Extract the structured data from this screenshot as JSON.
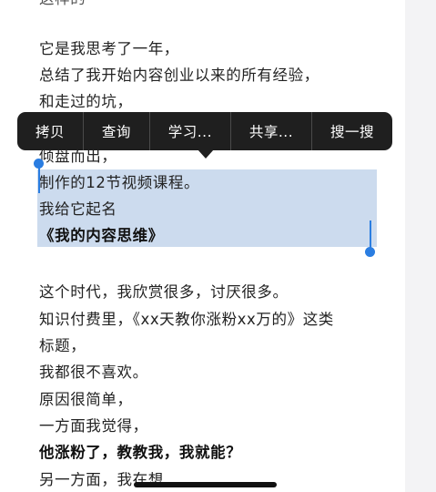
{
  "context_menu": {
    "items": [
      {
        "label": "拷贝"
      },
      {
        "label": "查询"
      },
      {
        "label": "学习..."
      },
      {
        "label": "共享..."
      },
      {
        "label": "搜一搜"
      }
    ]
  },
  "article": {
    "lines": [
      {
        "text": "这样的"
      },
      {
        "text": "它是我思考了一年，"
      },
      {
        "text": "总结了我开始内容创业以来的所有经验，"
      },
      {
        "text": "和走过的坑，"
      },
      {
        "text": "倾盘而出，"
      },
      {
        "text": "制作的12节视频课程。"
      },
      {
        "text": "我给它起名"
      },
      {
        "text": "《我的内容思维》"
      },
      {
        "text": "这个时代，我欣赏很多，讨厌很多。"
      },
      {
        "text": "知识付费里，《xx天教你涨粉xx万的》这类"
      },
      {
        "text": "标题，"
      },
      {
        "text": "我都很不喜欢。"
      },
      {
        "text": "原因很简单，"
      },
      {
        "text": "一方面我觉得，"
      },
      {
        "text": "他涨粉了，教教我，我就能？"
      },
      {
        "text": "另一方面，我在想"
      }
    ]
  },
  "colors": {
    "selection": "#a9c3e3",
    "handle": "#2a7de1",
    "menu_bg": "#1f1f1f"
  }
}
